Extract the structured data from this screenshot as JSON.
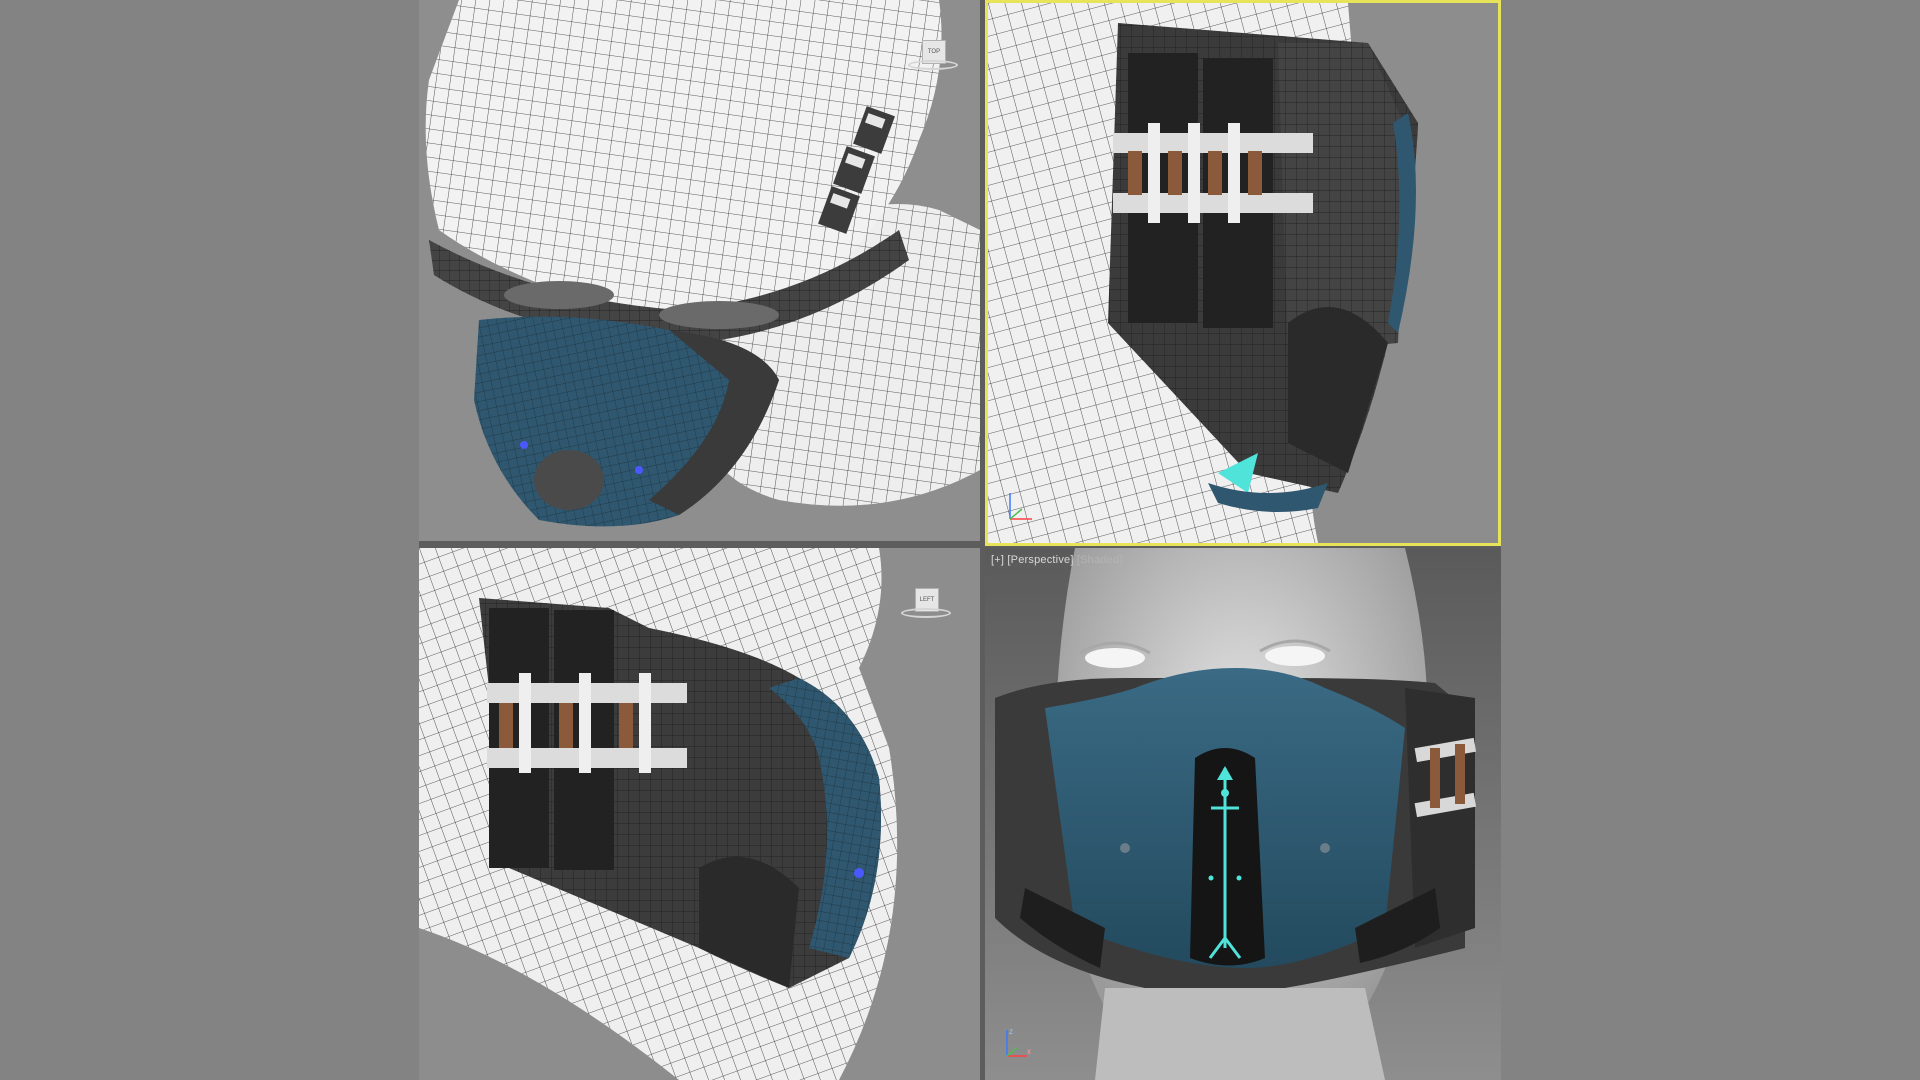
{
  "viewports": {
    "perspective": {
      "label_plus": "[+]",
      "label_view": "[Perspective]",
      "label_shading": "[Shaded]"
    },
    "top": {
      "viewcube_face": "TOP"
    },
    "left": {
      "viewcube_face": "LEFT"
    }
  },
  "colors": {
    "background": "#838383",
    "active_viewport_border": "#e8e45a",
    "mask_blue": "#2f5870",
    "mask_dark": "#3a3a3a",
    "glow_cyan": "#4fe3d9",
    "strap_brown": "#8a5a3a"
  },
  "axis_labels": {
    "z": "z",
    "x": "x"
  }
}
